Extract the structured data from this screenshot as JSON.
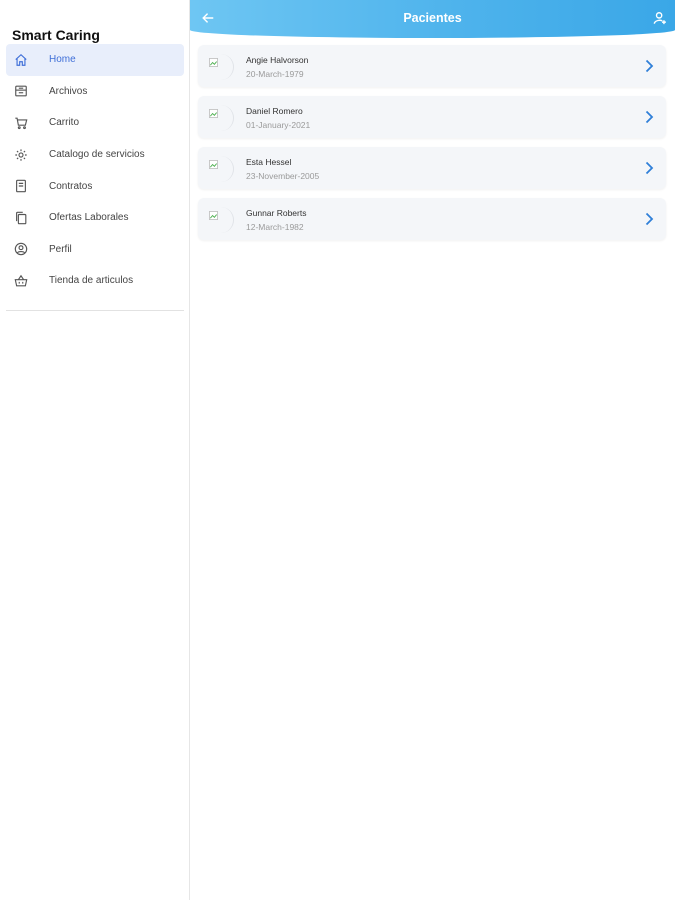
{
  "sidebar": {
    "app_title": "Smart Caring",
    "items": [
      {
        "label": "Home",
        "icon": "home-icon",
        "active": true
      },
      {
        "label": "Archivos",
        "icon": "archive-icon",
        "active": false
      },
      {
        "label": "Carrito",
        "icon": "cart-icon",
        "active": false
      },
      {
        "label": "Catalogo de servicios",
        "icon": "gear-icon",
        "active": false
      },
      {
        "label": "Contratos",
        "icon": "document-icon",
        "active": false
      },
      {
        "label": "Ofertas Laborales",
        "icon": "copy-icon",
        "active": false
      },
      {
        "label": "Perfil",
        "icon": "user-circle-icon",
        "active": false
      },
      {
        "label": "Tienda de articulos",
        "icon": "basket-icon",
        "active": false
      }
    ]
  },
  "header": {
    "title": "Pacientes",
    "back_icon": "arrow-left-icon",
    "action_icon": "add-user-icon",
    "colors": {
      "start": "#6ec6f3",
      "end": "#3aa7e7"
    }
  },
  "patients": [
    {
      "name": "Angie Halvorson",
      "birthdate": "20-March-1979"
    },
    {
      "name": "Daniel Romero",
      "birthdate": "01-January-2021"
    },
    {
      "name": "Esta Hessel",
      "birthdate": "23-November-2005"
    },
    {
      "name": "Gunnar Roberts",
      "birthdate": "12-March-1982"
    }
  ],
  "colors": {
    "accent": "#3f6fd8",
    "active_bg": "#e8eefb",
    "card_bg": "#f4f6f9",
    "chevron": "#2f7fd8"
  }
}
